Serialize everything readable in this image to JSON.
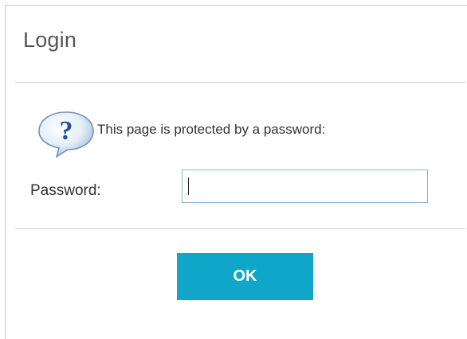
{
  "dialog": {
    "title": "Login",
    "message": "This page is protected by a password:",
    "password_label": "Password:",
    "password_value": "",
    "ok_label": "OK"
  },
  "icons": {
    "help": "help-question-bubble-icon"
  },
  "colors": {
    "ok_button": "#0fa6c9",
    "input_border": "#8fb3d6",
    "title_text": "#555555"
  }
}
